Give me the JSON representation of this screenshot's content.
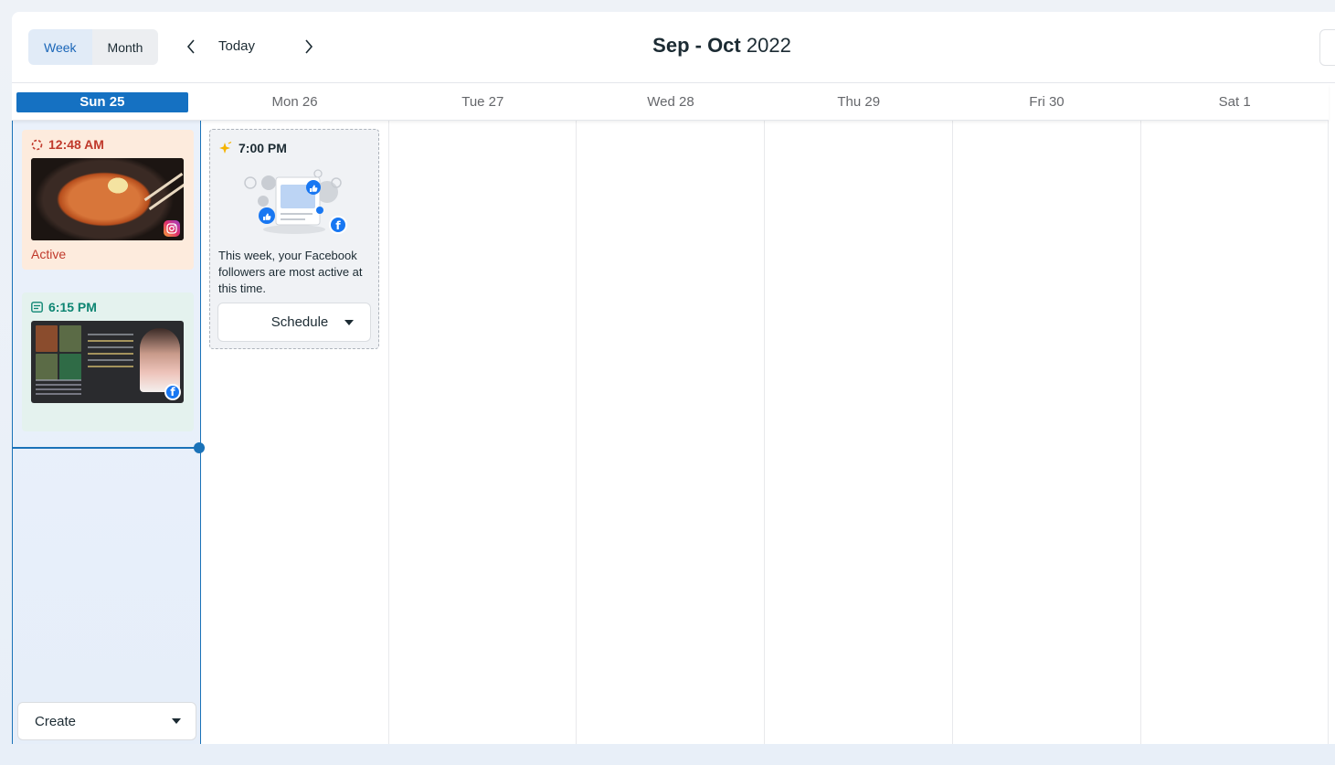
{
  "toolbar": {
    "view_week": "Week",
    "view_month": "Month",
    "today": "Today",
    "title_bold": "Sep - Oct",
    "title_year": "2022"
  },
  "days": [
    {
      "label": "Sun 25",
      "today": true
    },
    {
      "label": "Mon 26",
      "today": false
    },
    {
      "label": "Tue 27",
      "today": false
    },
    {
      "label": "Wed 28",
      "today": false
    },
    {
      "label": "Thu 29",
      "today": false
    },
    {
      "label": "Fri 30",
      "today": false
    },
    {
      "label": "Sat 1",
      "today": false
    }
  ],
  "posts": {
    "instagram": {
      "time": "12:48 AM",
      "status": "Active",
      "platform_icon": "instagram-icon",
      "status_icon": "spinner-icon",
      "accent": "#c0392b",
      "background": "#fdebdd"
    },
    "facebook": {
      "time": "6:15 PM",
      "platform_icon": "facebook-icon",
      "type_icon": "post-icon",
      "accent": "#0d8572",
      "background": "#e4f2ee"
    }
  },
  "suggestion": {
    "time": "7:00 PM",
    "text": "This week, your Facebook followers are most active at this time.",
    "button": "Schedule",
    "icon": "sparkle-icon"
  },
  "create_button": "Create",
  "colors": {
    "accent_blue": "#1571c2",
    "now_line": "#1a72b8"
  }
}
